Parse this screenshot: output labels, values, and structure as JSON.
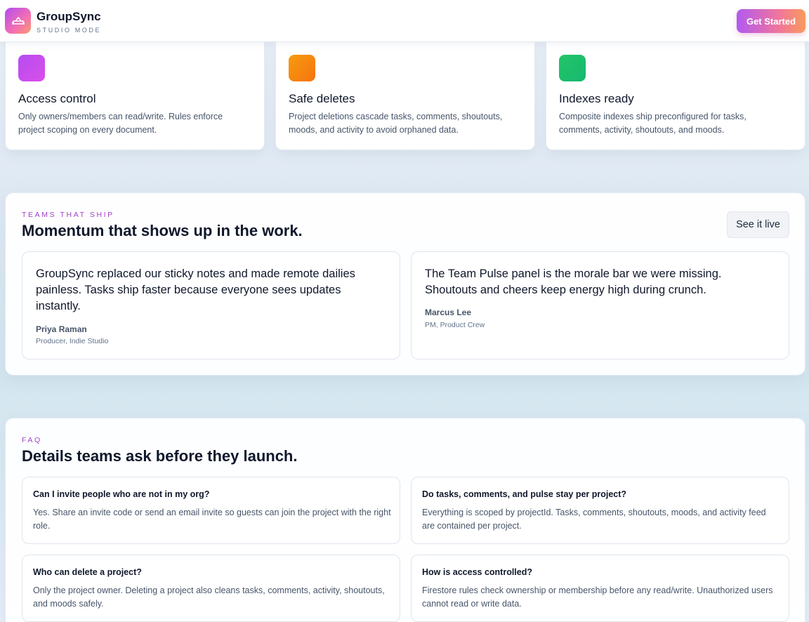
{
  "header": {
    "brand": "GroupSync",
    "mode": "STUDIO MODE",
    "logo_icon": "sofa-icon",
    "cta_label": "Get Started"
  },
  "features": [
    {
      "title": "Access control",
      "description": "Only owners/members can read/write. Rules enforce project scoping on every document.",
      "color": "#c24df0"
    },
    {
      "title": "Safe deletes",
      "description": "Project deletions cascade tasks, comments, shoutouts, moods, and activity to avoid orphaned data.",
      "color": "#f7900f"
    },
    {
      "title": "Indexes ready",
      "description": "Composite indexes ship preconfigured for tasks, comments, activity, shoutouts, and moods.",
      "color": "#1cbf6b"
    }
  ],
  "testimonials": {
    "eyebrow": "TEAMS THAT SHIP",
    "title": "Momentum that shows up in the work.",
    "button_label": "See it live",
    "items": [
      {
        "quote": "GroupSync replaced our sticky notes and made remote dailies painless. Tasks ship faster because everyone sees updates instantly.",
        "name": "Priya Raman",
        "role": "Producer, Indie Studio"
      },
      {
        "quote": "The Team Pulse panel is the morale bar we were missing. Shoutouts and cheers keep energy high during crunch.",
        "name": "Marcus Lee",
        "role": "PM, Product Crew"
      }
    ]
  },
  "faq": {
    "eyebrow": "FAQ",
    "title": "Details teams ask before they launch.",
    "items": [
      {
        "question": "Can I invite people who are not in my org?",
        "answer": "Yes. Share an invite code or send an email invite so guests can join the project with the right role."
      },
      {
        "question": "Do tasks, comments, and pulse stay per project?",
        "answer": "Everything is scoped by projectId. Tasks, comments, shoutouts, moods, and activity feed are contained per project."
      },
      {
        "question": "Who can delete a project?",
        "answer": "Only the project owner. Deleting a project also cleans tasks, comments, activity, shoutouts, and moods safely."
      },
      {
        "question": "How is access controlled?",
        "answer": "Firestore rules check ownership or membership before any read/write. Unauthorized users cannot read or write data."
      }
    ]
  }
}
